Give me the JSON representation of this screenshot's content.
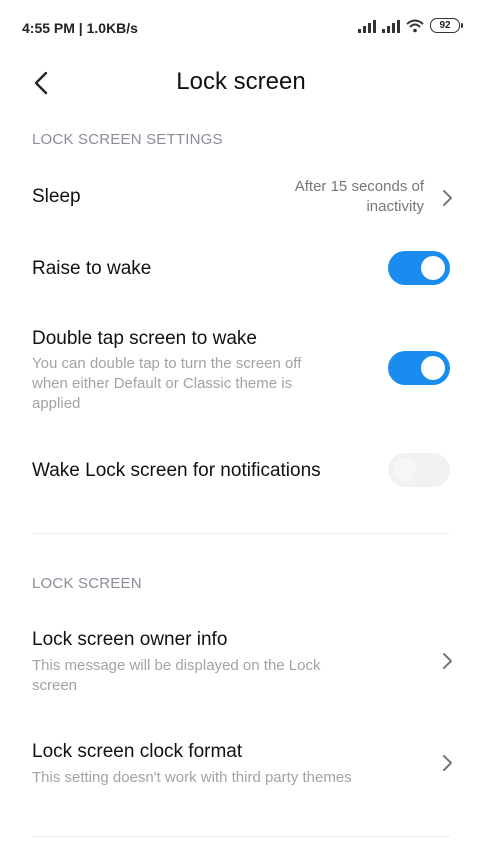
{
  "status_bar": {
    "time_speed": "4:55 PM | 1.0KB/s",
    "battery": "92"
  },
  "header": {
    "title": "Lock screen"
  },
  "sections": {
    "settings_header": "LOCK SCREEN SETTINGS",
    "lock_screen_header": "LOCK SCREEN"
  },
  "sleep": {
    "label": "Sleep",
    "value_line1": "After 15 seconds of",
    "value_line2": "inactivity"
  },
  "raise_to_wake": {
    "label": "Raise to wake",
    "enabled": true
  },
  "double_tap": {
    "label": "Double tap screen to wake",
    "desc_line1": "You can double tap to turn the screen off",
    "desc_line2": "when either Default or Classic theme is",
    "desc_line3": "applied",
    "enabled": true
  },
  "wake_notifications": {
    "label": "Wake Lock screen for notifications",
    "enabled": false
  },
  "owner_info": {
    "label": "Lock screen owner info",
    "desc_line1": "This message will be displayed on the Lock",
    "desc_line2": "screen"
  },
  "clock_format": {
    "label": "Lock screen clock format",
    "desc": "This setting doesn't work with third party themes"
  },
  "colors": {
    "accent": "#1a8cf0",
    "section_header": "#8c8c9a"
  }
}
